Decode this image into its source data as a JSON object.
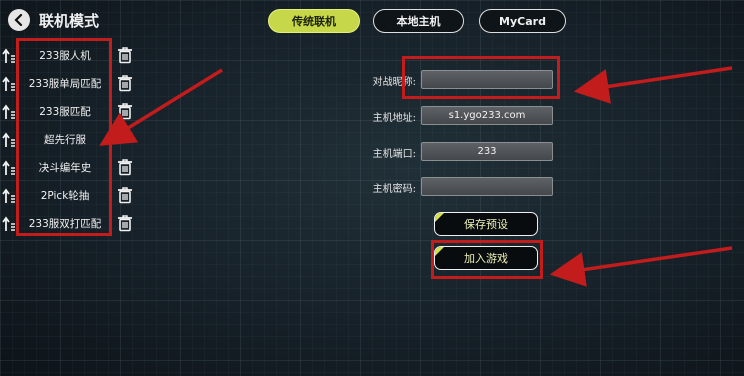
{
  "header": {
    "title": "联机模式",
    "back_icon": "chevron-left-icon"
  },
  "tabs": [
    {
      "label": "传统联机",
      "active": true
    },
    {
      "label": "本地主机",
      "active": false
    },
    {
      "label": "MyCard",
      "active": false
    }
  ],
  "servers": [
    {
      "label": "233服人机",
      "deletable": true
    },
    {
      "label": "233服单局匹配",
      "deletable": true
    },
    {
      "label": "233服匹配",
      "deletable": true
    },
    {
      "label": "超先行服",
      "deletable": false
    },
    {
      "label": "决斗编年史",
      "deletable": true
    },
    {
      "label": "2Pick轮抽",
      "deletable": true
    },
    {
      "label": "233服双打匹配",
      "deletable": true
    }
  ],
  "form": {
    "nickname": {
      "label": "对战昵称:",
      "value": ""
    },
    "host": {
      "label": "主机地址:",
      "value": "s1.ygo233.com"
    },
    "port": {
      "label": "主机端口:",
      "value": "233"
    },
    "password": {
      "label": "主机密码:",
      "value": ""
    }
  },
  "buttons": {
    "save": "保存预设",
    "join": "加入游戏"
  },
  "colors": {
    "accent": "#c6d84a",
    "annotation": "#c21c1c"
  }
}
